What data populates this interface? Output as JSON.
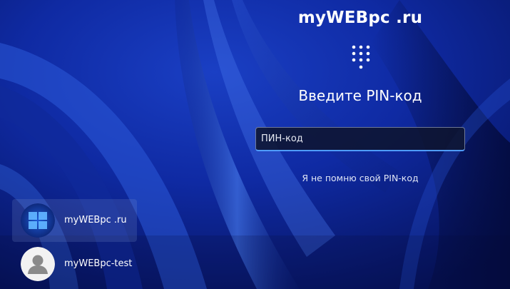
{
  "header": {
    "title": "myWEBpc .ru"
  },
  "pin_pad_icon": "pin-keypad-icon",
  "login": {
    "prompt": "Введите PIN-код",
    "pin_placeholder": "ПИН-код",
    "pin_value": "",
    "forgot_link": "Я не помню свой PIN-код"
  },
  "users": [
    {
      "name": "myWEBpc .ru",
      "avatar": "windows-logo-avatar",
      "selected": true
    },
    {
      "name": "myWEBpc-test",
      "avatar": "default-person-avatar",
      "selected": false
    }
  ],
  "colors": {
    "background": "#0a1f8a",
    "input_accent": "#4f9cff"
  }
}
